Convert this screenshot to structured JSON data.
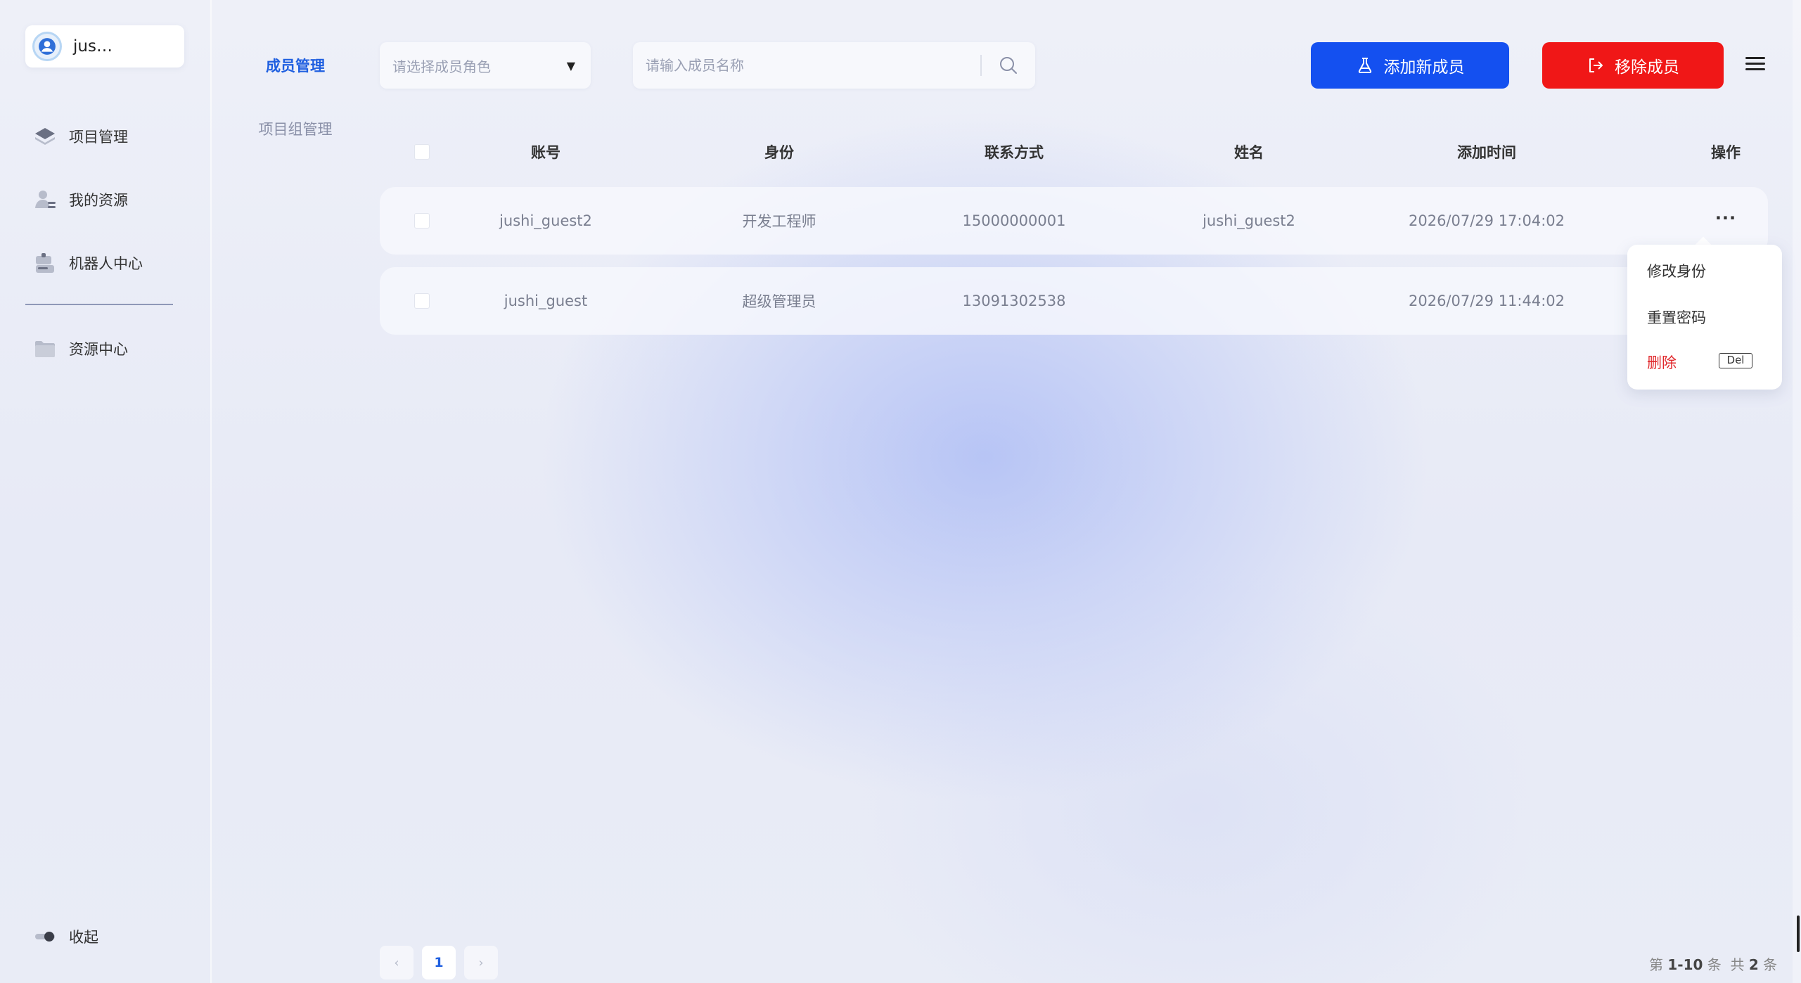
{
  "user": {
    "name": "jus…"
  },
  "sidebar": {
    "items": [
      {
        "label": "项目管理",
        "icon": "layers-icon"
      },
      {
        "label": "我的资源",
        "icon": "person-icon"
      },
      {
        "label": "机器人中心",
        "icon": "robot-icon"
      },
      {
        "label": "资源中心",
        "icon": "folder-icon"
      }
    ],
    "collapse_label": "收起"
  },
  "subnav": {
    "items": [
      "成员管理",
      "项目组管理"
    ],
    "active": "成员管理"
  },
  "toolbar": {
    "role_select_placeholder": "请选择成员角色",
    "search_placeholder": "请输入成员名称",
    "add_label": "添加新成员",
    "remove_label": "移除成员"
  },
  "table": {
    "columns": [
      "账号",
      "身份",
      "联系方式",
      "姓名",
      "添加时间",
      "操作"
    ],
    "rows": [
      {
        "account": "jushi_guest2",
        "role": "开发工程师",
        "phone": "15000000001",
        "name": "jushi_guest2",
        "time": "2026/07/29 17:04:02"
      },
      {
        "account": "jushi_guest",
        "role": "超级管理员",
        "phone": "13091302538",
        "name": "",
        "time": "2026/07/29 11:44:02"
      }
    ],
    "more_label": "···"
  },
  "dropdown": {
    "items": [
      "修改身份",
      "重置密码"
    ],
    "delete_label": "删除",
    "delete_shortcut": "Del"
  },
  "pagination": {
    "current_page": "1",
    "info_prefix": "第",
    "range": "1-10",
    "info_mid": "条  共",
    "total": "2",
    "info_suffix": "条"
  },
  "colors": {
    "primary": "#1450f0",
    "danger": "#f01717",
    "active_link": "#1f5fe0"
  }
}
